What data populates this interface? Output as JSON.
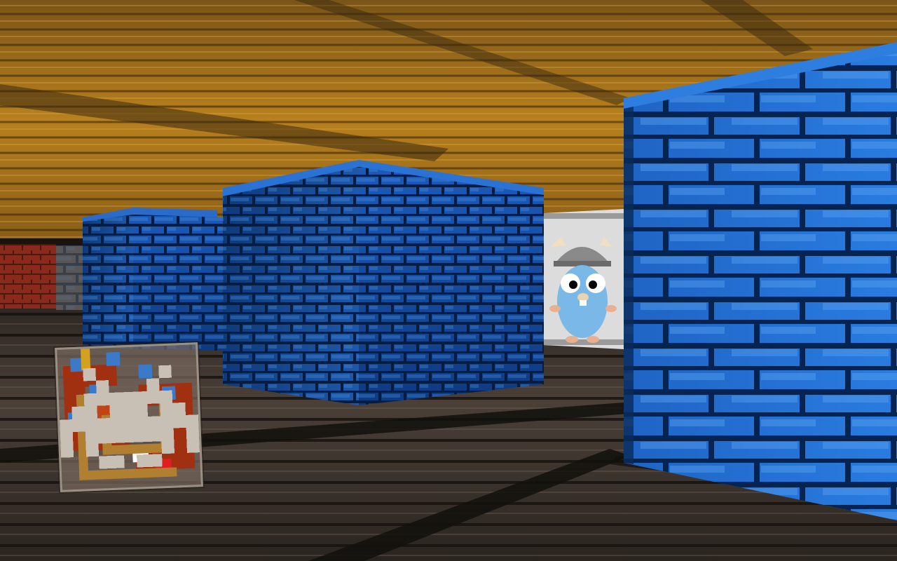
{
  "game": {
    "view": "first-person-maze",
    "colors": {
      "ceiling": "#b07a20",
      "ceiling_dark": "#5a3c10",
      "floor": "#3e3630",
      "floor_dark": "#1e1a16",
      "wall_blue": "#2a78d8",
      "wall_blue_dark": "#0a2a58",
      "wall_red": "#8a2a1c",
      "banner_bg": "#e6e6e6",
      "gopher": "#7ab8e8"
    },
    "sprites": [
      {
        "name": "gopher-viking-banner",
        "kind": "wall-sprite"
      }
    ],
    "hud": {
      "minimap": {
        "icons": [
          "spiral-glyph-icon",
          "colored-dots-icon",
          "maze-glyph-icon",
          "space-invader-icon"
        ],
        "colors": {
          "glyph_red": "#a03010",
          "glyph_gold": "#d4a020",
          "dots_blue": "#3a7ac8",
          "dot_orange": "#e08020",
          "dot_white": "#ffffff",
          "dot_red": "#e02020",
          "invader": "#c8c0b4"
        }
      }
    }
  }
}
